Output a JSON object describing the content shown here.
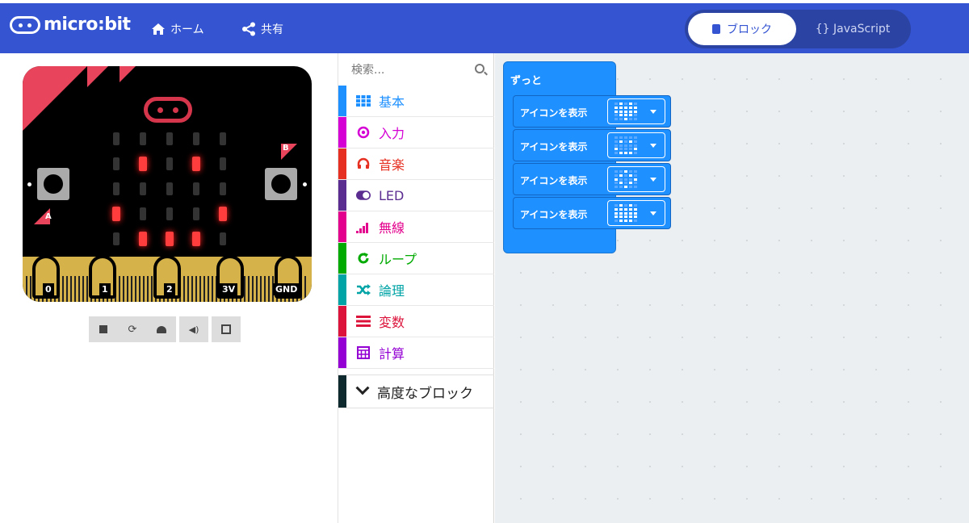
{
  "header": {
    "logo_text": "micro:bit",
    "home_label": "ホーム",
    "share_label": "共有",
    "blocks_label": "ブロック",
    "js_label": "{} JavaScript"
  },
  "simulator": {
    "button_a": "A",
    "button_b": "B",
    "pins": [
      "0",
      "1",
      "2",
      "3V",
      "GND"
    ],
    "leds_on": [
      [
        1,
        1
      ],
      [
        1,
        3
      ],
      [
        3,
        0
      ],
      [
        3,
        4
      ],
      [
        4,
        1
      ],
      [
        4,
        2
      ],
      [
        4,
        3
      ]
    ],
    "controls": [
      "stop",
      "restart",
      "slow-motion",
      "mute",
      "fullscreen"
    ]
  },
  "toolbox": {
    "search_placeholder": "検索...",
    "categories": [
      {
        "label": "基本",
        "color": "#1e90ff",
        "icon": "grid-icon"
      },
      {
        "label": "入力",
        "color": "#d400d4",
        "icon": "target-icon"
      },
      {
        "label": "音楽",
        "color": "#e63022",
        "icon": "headphones-icon"
      },
      {
        "label": "LED",
        "color": "#5c2d91",
        "icon": "toggle-icon"
      },
      {
        "label": "無線",
        "color": "#e3008c",
        "icon": "signal-icon"
      },
      {
        "label": "ループ",
        "color": "#00aa00",
        "icon": "loop-icon"
      },
      {
        "label": "論理",
        "color": "#00a4a6",
        "icon": "shuffle-icon"
      },
      {
        "label": "変数",
        "color": "#dc143c",
        "icon": "list-icon"
      },
      {
        "label": "計算",
        "color": "#9400d3",
        "icon": "calculator-icon"
      }
    ],
    "advanced_label": "高度なブロック"
  },
  "workspace": {
    "forever_label": "ずっと",
    "blocks": [
      {
        "label": "アイコンを表示",
        "icon": "heart"
      },
      {
        "label": "アイコンを表示",
        "icon": "happy"
      },
      {
        "label": "アイコンを表示",
        "icon": "small-diamond"
      },
      {
        "label": "アイコンを表示",
        "icon": "big-heart"
      }
    ]
  },
  "colors": {
    "header": "#3454d1",
    "block": "#1e90ff",
    "led_on": "#ff3d3d",
    "board_edge": "#d6b34a"
  }
}
